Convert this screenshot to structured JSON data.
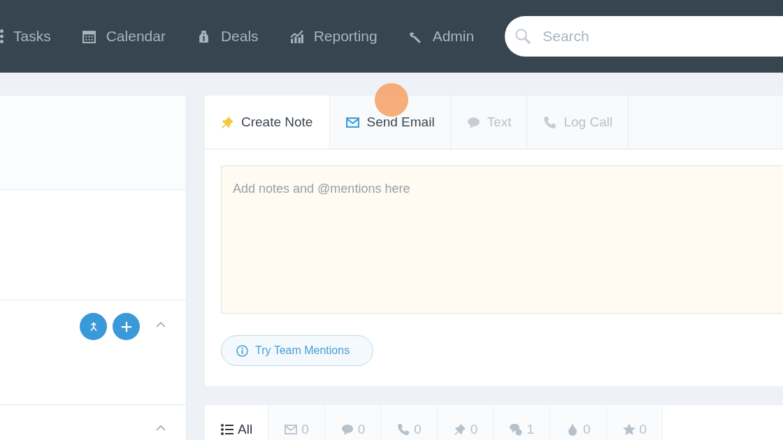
{
  "nav": [
    {
      "kind": "tasks",
      "label": "Tasks"
    },
    {
      "kind": "calendar",
      "label": "Calendar"
    },
    {
      "kind": "deals",
      "label": "Deals"
    },
    {
      "kind": "reporting",
      "label": "Reporting"
    },
    {
      "kind": "admin",
      "label": "Admin"
    }
  ],
  "search": {
    "placeholder": "Search"
  },
  "composer_tabs": [
    {
      "kind": "note",
      "label": "Create Note",
      "selected": true,
      "disabled": false
    },
    {
      "kind": "email",
      "label": "Send Email",
      "selected": false,
      "disabled": false
    },
    {
      "kind": "text",
      "label": "Text",
      "selected": false,
      "disabled": true
    },
    {
      "kind": "call",
      "label": "Log Call",
      "selected": false,
      "disabled": true
    }
  ],
  "note": {
    "placeholder": "Add notes and @mentions here"
  },
  "mentions_button": "Try Team Mentions",
  "filters": [
    {
      "kind": "all",
      "label": "All",
      "selected": true
    },
    {
      "kind": "email",
      "label": "0",
      "selected": false
    },
    {
      "kind": "text",
      "label": "0",
      "selected": false
    },
    {
      "kind": "call",
      "label": "0",
      "selected": false
    },
    {
      "kind": "note",
      "label": "0",
      "selected": false
    },
    {
      "kind": "chat",
      "label": "1",
      "selected": false
    },
    {
      "kind": "drop",
      "label": "0",
      "selected": false
    },
    {
      "kind": "star",
      "label": "0",
      "selected": false
    }
  ]
}
